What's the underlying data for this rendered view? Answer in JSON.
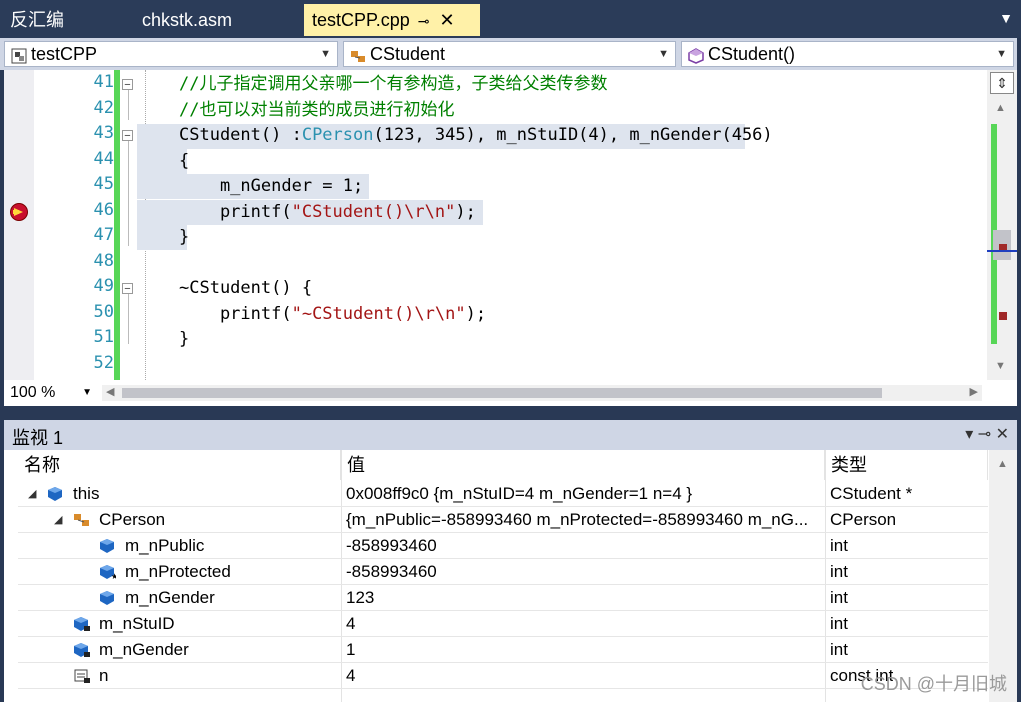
{
  "tabs": {
    "disasm": "反汇编",
    "chkstk": "chkstk.asm",
    "active": "testCPP.cpp",
    "pin_glyph": "⊸",
    "close_glyph": "✕",
    "menu_glyph": "▼"
  },
  "nav": {
    "project": "testCPP",
    "class": "CStudent",
    "member": "CStudent()"
  },
  "editor": {
    "line_numbers": [
      "41",
      "42",
      "43",
      "44",
      "45",
      "46",
      "47",
      "48",
      "49",
      "50",
      "51",
      "52"
    ],
    "code": {
      "l41": "//儿子指定调用父亲哪一个有参构造，子类给父类传参数",
      "l42": "//也可以对当前类的成员进行初始化",
      "l43_a": "CStudent() :",
      "l43_b": "CPerson",
      "l43_c": "(123, 345), m_nStuID(4), m_nGender(456)",
      "l44": "{",
      "l45": "    m_nGender = 1;",
      "l46_a": "    printf(",
      "l46_b": "\"CStudent()\\r\\n\"",
      "l46_c": ");",
      "l47": "}",
      "l49": "~CStudent() {",
      "l50_a": "    printf(",
      "l50_b": "\"~CStudent()\\r\\n\"",
      "l50_c": ");",
      "l51": "}"
    },
    "zoom": "100 %"
  },
  "watch": {
    "title": "监视 1",
    "title_buttons": "▾  ⊸  ✕",
    "headers": {
      "name": "名称",
      "value": "值",
      "type": "类型"
    },
    "rows": [
      {
        "name": "this",
        "value": "0x008ff9c0 {m_nStuID=4 m_nGender=1 n=4 }",
        "type": "CStudent *"
      },
      {
        "name": "CPerson",
        "value": "{m_nPublic=-858993460 m_nProtected=-858993460 m_nG...",
        "type": "CPerson"
      },
      {
        "name": "m_nPublic",
        "value": "-858993460",
        "type": "int"
      },
      {
        "name": "m_nProtected",
        "value": "-858993460",
        "type": "int"
      },
      {
        "name": "m_nGender",
        "value": "123",
        "type": "int"
      },
      {
        "name": "m_nStuID",
        "value": "4",
        "type": "int"
      },
      {
        "name": "m_nGender",
        "value": "1",
        "type": "int"
      },
      {
        "name": "n",
        "value": "4",
        "type": "const int"
      }
    ]
  },
  "watermark": "CSDN @十月旧城",
  "colors": {
    "accent_tab": "#fff1a8",
    "comment": "#008000",
    "string": "#a31515",
    "type": "#2b91af"
  }
}
